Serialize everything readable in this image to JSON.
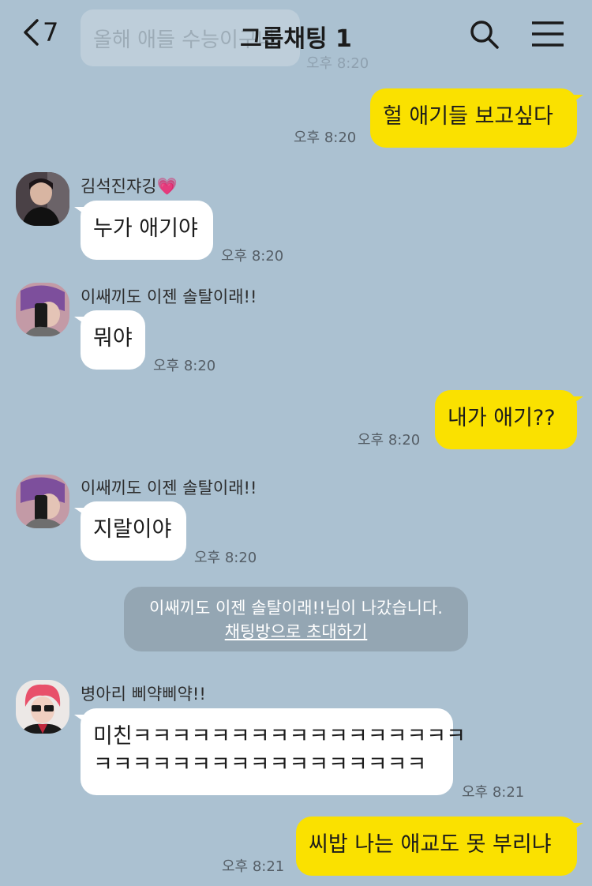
{
  "header": {
    "back_count": "7",
    "title": "그룹채팅 1"
  },
  "toast": {
    "text": "올해 애들 수능이구나",
    "time": "오후 8:20"
  },
  "messages": [
    {
      "text": "헐 애기들 보고싶다",
      "time": "오후 8:20"
    },
    {
      "sender": "김석진쟈깅💗",
      "text": "누가 애기야",
      "time": "오후 8:20"
    },
    {
      "sender": "이쌔끼도 이젠 솔탈이래!!",
      "text": "뭐야",
      "time": "오후 8:20"
    },
    {
      "text": "내가 애기??",
      "time": "오후 8:20"
    },
    {
      "sender": "이쌔끼도 이젠 솔탈이래!!",
      "text": "지랄이야",
      "time": "오후 8:20"
    },
    {
      "sender": "병아리 삐약삐약!!",
      "line1": "미친ㅋㅋㅋㅋㅋㅋㅋㅋㅋㅋㅋㅋㅋㅋㅋㅋㅋ",
      "line2": "ㅋㅋㅋㅋㅋㅋㅋㅋㅋㅋㅋㅋㅋㅋㅋㅋㅋ",
      "time": "오후 8:21"
    },
    {
      "text": "씨밥 나는 애교도 못 부리냐",
      "time": "오후 8:21"
    }
  ],
  "system": {
    "text": "이쌔끼도 이젠 솔탈이래!!님이 나갔습니다.",
    "link": "채팅방으로 초대하기"
  },
  "colors": {
    "background": "#abc1d1",
    "my_bubble": "#fae100",
    "other_bubble": "#ffffff",
    "system_bar": "#94a6b3"
  },
  "icons": [
    "back-chevron-icon",
    "search-icon",
    "menu-icon"
  ]
}
